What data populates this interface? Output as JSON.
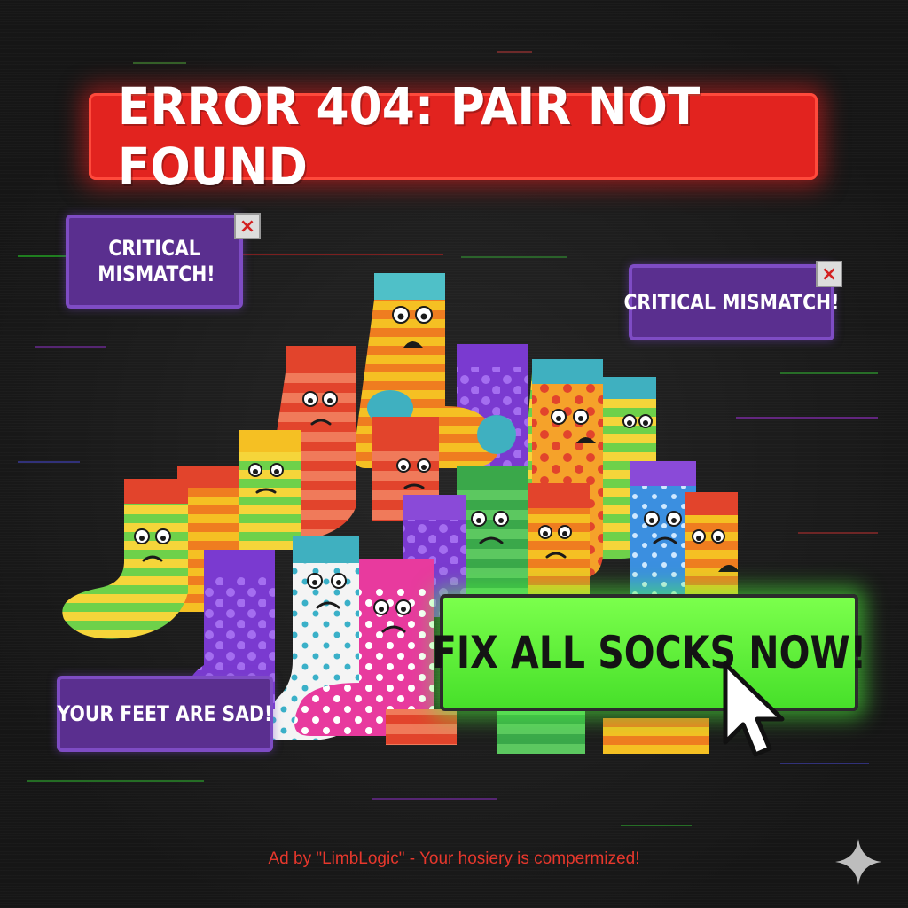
{
  "banner": {
    "text": "ERROR 404: PAIR NOT FOUND"
  },
  "popups": [
    {
      "text": "CRITICAL MISMATCH!",
      "close": "×"
    },
    {
      "text": "CRITICAL MISMATCH!",
      "close": "×"
    },
    {
      "text": "YOUR FEET ARE SAD!"
    }
  ],
  "cta": {
    "label": "FIX ALL SOCKS NOW!"
  },
  "footer": {
    "text": "Ad by \"LimbLogic\" - Your hosiery is compermized!"
  },
  "colors": {
    "banner": "#e2231f",
    "popup": "#5a2f8f",
    "cta": "#5fef35",
    "footer": "#e6372c",
    "background": "#1b1b1b"
  },
  "icons": {
    "close": "close-icon",
    "cursor": "mouse-pointer-icon",
    "sparkle": "sparkle-icon"
  }
}
